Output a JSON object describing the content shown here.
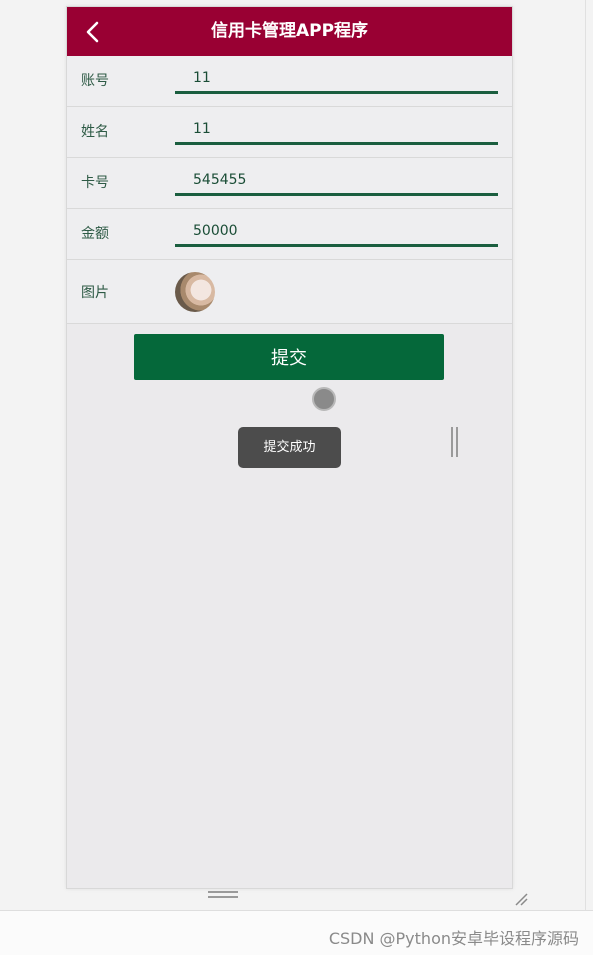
{
  "header": {
    "title": "信用卡管理APP程序",
    "back_icon": "chevron-left-icon"
  },
  "form": {
    "rows": [
      {
        "label": "账号",
        "value": "11"
      },
      {
        "label": "姓名",
        "value": "11"
      },
      {
        "label": "卡号",
        "value": "545455"
      },
      {
        "label": "金额",
        "value": "50000"
      }
    ],
    "image_label": "图片"
  },
  "actions": {
    "submit_label": "提交"
  },
  "toast": {
    "message": "提交成功"
  },
  "footer": {
    "watermark": "CSDN @Python安卓毕设程序源码"
  },
  "colors": {
    "header_bg": "#990033",
    "accent_green": "#05683a",
    "input_underline": "#1a5e3f",
    "toast_bg": "#4c4c4c"
  }
}
